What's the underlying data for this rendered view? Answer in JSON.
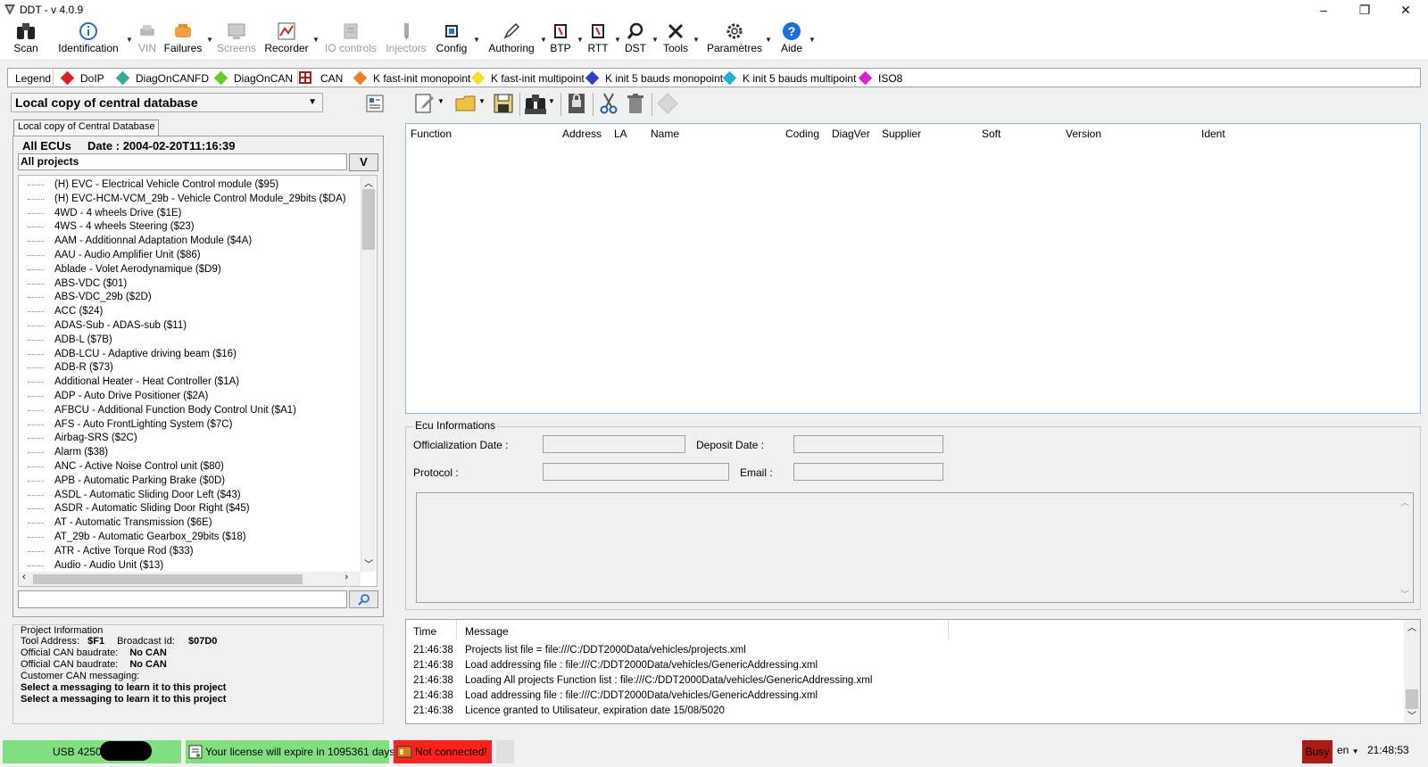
{
  "window": {
    "title": "DDT - v 4.0.9",
    "minimize": "–",
    "restore": "❐",
    "close": "✕"
  },
  "toolbar": {
    "scan": "Scan",
    "identification": "Identification",
    "vin": "VIN",
    "failures": "Failures",
    "screens": "Screens",
    "recorder": "Recorder",
    "io_controls": "IO controls",
    "injectors": "Injectors",
    "config": "Config",
    "authoring": "Authoring",
    "btp": "BTP",
    "rtt": "RTT",
    "dst": "DST",
    "tools": "Tools",
    "parametres": "Paramètres",
    "aide": "Aide"
  },
  "legend": {
    "title": "Legend",
    "items": [
      {
        "label": "DoIP",
        "color": "#e02020"
      },
      {
        "label": "DiagOnCANFD",
        "color": "#30b090"
      },
      {
        "label": "DiagOnCAN",
        "color": "#60d020"
      },
      {
        "label": "CAN",
        "color": "#a02020"
      },
      {
        "label": "K fast-init monopoint",
        "color": "#f08020"
      },
      {
        "label": "K fast-init multipoint",
        "color": "#f0e020"
      },
      {
        "label": "K init 5 bauds monopoint",
        "color": "#3040d0"
      },
      {
        "label": "K init 5 bauds multipoint",
        "color": "#20b0d0"
      },
      {
        "label": "ISO8",
        "color": "#e020d0"
      }
    ]
  },
  "database": {
    "selected": "Local copy of central database",
    "tab_label": "Local copy of Central Database",
    "header": "All ECUs     Date : 2004-02-20T11:16:39",
    "project_filter": "All projects",
    "project_btn": "V",
    "ecus": [
      "(H) EVC - Electrical Vehicle Control module ($95)",
      "(H) EVC-HCM-VCM_29b - Vehicle Control Module_29bits ($DA)",
      "4WD - 4 wheels Drive ($1E)",
      "4WS - 4 wheels Steering ($23)",
      "AAM - Additionnal Adaptation Module ($4A)",
      "AAU - Audio Amplifier Unit ($86)",
      "Ablade - Volet Aerodynamique ($D9)",
      "ABS-VDC ($01)",
      "ABS-VDC_29b ($2D)",
      "ACC ($24)",
      "ADAS-Sub - ADAS-sub ($11)",
      "ADB-L ($7B)",
      "ADB-LCU - Adaptive driving beam ($16)",
      "ADB-R ($73)",
      "Additional Heater - Heat Controller ($1A)",
      "ADP - Auto Drive Positioner ($2A)",
      "AFBCU - Additional Function Body Control Unit ($A1)",
      "AFS - Auto FrontLighting System ($7C)",
      "Airbag-SRS ($2C)",
      "Alarm ($38)",
      "ANC - Active Noise Control unit ($80)",
      "APB - Automatic Parking Brake ($0D)",
      "ASDL - Automatic Sliding Door Left ($43)",
      "ASDR - Automatic Sliding Door Right ($45)",
      "AT - Automatic Transmission ($6E)",
      "AT_29b - Automatic Gearbox_29bits ($18)",
      "ATR - Active Torque Rod ($33)",
      "Audio - Audio Unit ($13)"
    ],
    "search_value": ""
  },
  "project_info": {
    "title": "Project Information",
    "tool_address_label": "Tool Address:",
    "tool_address": "$F1",
    "broadcast_label": "Broadcast Id:",
    "broadcast": "$07D0",
    "official_can_label": "Official CAN baudrate:",
    "official_can_1": "No CAN",
    "official_can_2": "No CAN",
    "customer_label": "Customer CAN messaging:",
    "msg1": "Select a messaging to learn it to this project",
    "msg2": "Select a messaging to learn it to this project"
  },
  "ecu_table": {
    "columns": [
      "Function",
      "Address",
      "LA",
      "Name",
      "Coding",
      "DiagVer",
      "Supplier",
      "Soft",
      "Version",
      "Ident"
    ]
  },
  "ecu_info": {
    "title": "Ecu Informations",
    "officialization_label": "Officialization Date :",
    "deposit_label": "Deposit Date :",
    "protocol_label": "Protocol :",
    "email_label": "Email :"
  },
  "log": {
    "time_header": "Time",
    "message_header": "Message",
    "rows": [
      {
        "time": "21:46:38",
        "message": "Projects list file = file:///C:/DDT2000Data/vehicles/projects.xml"
      },
      {
        "time": "21:46:38",
        "message": "Load addressing file : file:///C:/DDT2000Data/vehicles/GenericAddressing.xml"
      },
      {
        "time": "21:46:38",
        "message": "Loading All projects Function list : file:///C:/DDT2000Data/vehicles/GenericAddressing.xml"
      },
      {
        "time": "21:46:38",
        "message": "Load addressing file : file:///C:/DDT2000Data/vehicles/GenericAddressing.xml"
      },
      {
        "time": "21:46:38",
        "message": "Licence granted to Utilisateur, expiration date 15/08/5020"
      }
    ]
  },
  "status": {
    "usb": "USB 42501",
    "license": "Your license will expire in 1095361 days",
    "connection": "Not connected!",
    "busy": "Busy",
    "language": "en",
    "time": "21:48:53"
  }
}
